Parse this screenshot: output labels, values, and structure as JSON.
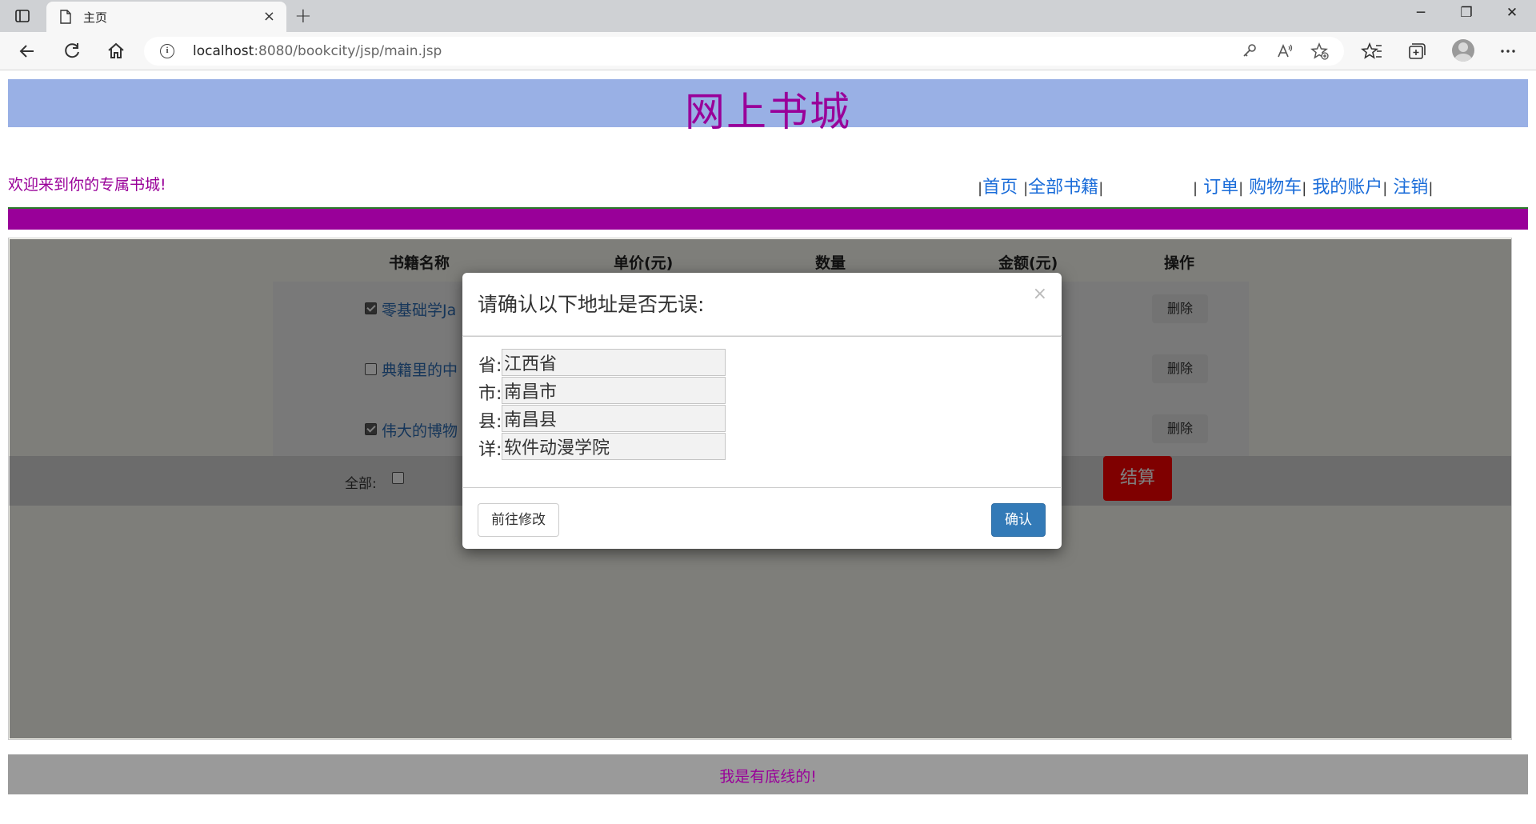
{
  "browser": {
    "tab_title": "主页",
    "tab_close": "×",
    "new_tab": "+",
    "url_host": "localhost",
    "url_rest": ":8080/bookcity/jsp/main.jsp",
    "info_glyph": "i",
    "minimize": "─",
    "restore": "❐",
    "close": "✕"
  },
  "site": {
    "title": "网上书城",
    "welcome": "欢迎来到你的专属书城!",
    "nav1": [
      {
        "label": "首页"
      },
      {
        "label": "全部书籍"
      }
    ],
    "nav2": [
      {
        "label": "订单"
      },
      {
        "label": "购物车"
      },
      {
        "label": "我的账户"
      },
      {
        "label": "注销"
      }
    ],
    "sep": "|"
  },
  "cart": {
    "headers": [
      "书籍名称",
      "单价(元)",
      "数量",
      "金额(元)",
      "操作"
    ],
    "rows": [
      {
        "name": "零基础学Ja",
        "checked": true,
        "action": "删除"
      },
      {
        "name": "典籍里的中",
        "checked": false,
        "action": "删除"
      },
      {
        "name": "伟大的博物",
        "checked": true,
        "action": "删除"
      }
    ],
    "select_all_label": "全部:",
    "checkout_label": "结算"
  },
  "footer": {
    "text": "我是有底线的!"
  },
  "modal": {
    "title": "请确认以下地址是否无误:",
    "close": "×",
    "fields": [
      {
        "label": "省:",
        "value": "江西省"
      },
      {
        "label": "市:",
        "value": "南昌市"
      },
      {
        "label": "县:",
        "value": "南昌县"
      },
      {
        "label": "详:",
        "value": "软件动漫学院"
      }
    ],
    "back_button": "前往修改",
    "confirm_button": "确认"
  },
  "colors": {
    "brand_purple": "#990099",
    "header_blue": "#99b0e5",
    "link_blue": "#1a6cd9",
    "checkout_red": "#ff0000",
    "confirm_blue": "#337ab7"
  }
}
